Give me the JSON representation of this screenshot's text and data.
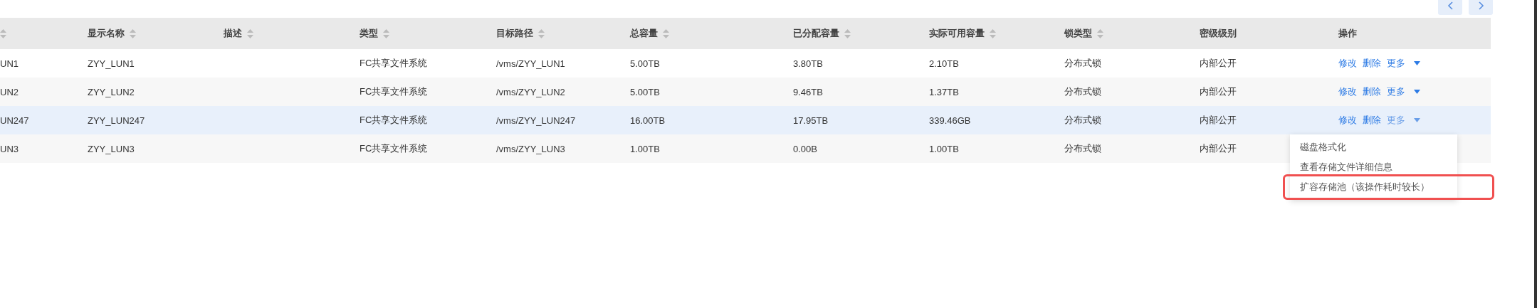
{
  "toolbar": {
    "buttons": [
      {
        "kind": "prev"
      },
      {
        "kind": "next"
      }
    ]
  },
  "table": {
    "columns": [
      {
        "sortable": true
      },
      {
        "label": "显示名称",
        "sortable": true
      },
      {
        "label": "描述",
        "sortable": true
      },
      {
        "label": "类型",
        "sortable": true
      },
      {
        "label": "目标路径",
        "sortable": true
      },
      {
        "label": "总容量",
        "sortable": true
      },
      {
        "label": "已分配容量",
        "sortable": true
      },
      {
        "label": "实际可用容量",
        "sortable": true
      },
      {
        "label": "锁类型",
        "sortable": true
      },
      {
        "label": "密级级别",
        "sortable": false
      },
      {
        "label": "操作",
        "sortable": false
      }
    ],
    "rows": [
      {
        "selected": false,
        "cells": [
          "UN1",
          "ZYY_LUN1",
          "",
          "FC共享文件系统",
          "/vms/ZYY_LUN1",
          "5.00TB",
          "3.80TB",
          "2.10TB",
          "分布式锁",
          "内部公开"
        ],
        "actions": [
          "修改",
          "删除",
          "更多"
        ]
      },
      {
        "selected": false,
        "cells": [
          "UN2",
          "ZYY_LUN2",
          "",
          "FC共享文件系统",
          "/vms/ZYY_LUN2",
          "5.00TB",
          "9.46TB",
          "1.37TB",
          "分布式锁",
          "内部公开"
        ],
        "actions": [
          "修改",
          "删除",
          "更多"
        ]
      },
      {
        "selected": true,
        "cells": [
          "UN247",
          "ZYY_LUN247",
          "",
          "FC共享文件系统",
          "/vms/ZYY_LUN247",
          "16.00TB",
          "17.95TB",
          "339.46GB",
          "分布式锁",
          "内部公开"
        ],
        "actions": [
          "修改",
          "删除",
          "更多"
        ]
      },
      {
        "selected": false,
        "cells": [
          "UN3",
          "ZYY_LUN3",
          "",
          "FC共享文件系统",
          "/vms/ZYY_LUN3",
          "1.00TB",
          "0.00B",
          "1.00TB",
          "分布式锁",
          "内部公开"
        ]
      }
    ]
  },
  "dropdown_menu": {
    "items": [
      {
        "label": "磁盘格式化",
        "highlighted": false
      },
      {
        "label": "查看存储文件详细信息",
        "highlighted": false
      },
      {
        "label": "扩容存储池（该操作耗时较长）",
        "highlighted": true
      }
    ]
  }
}
